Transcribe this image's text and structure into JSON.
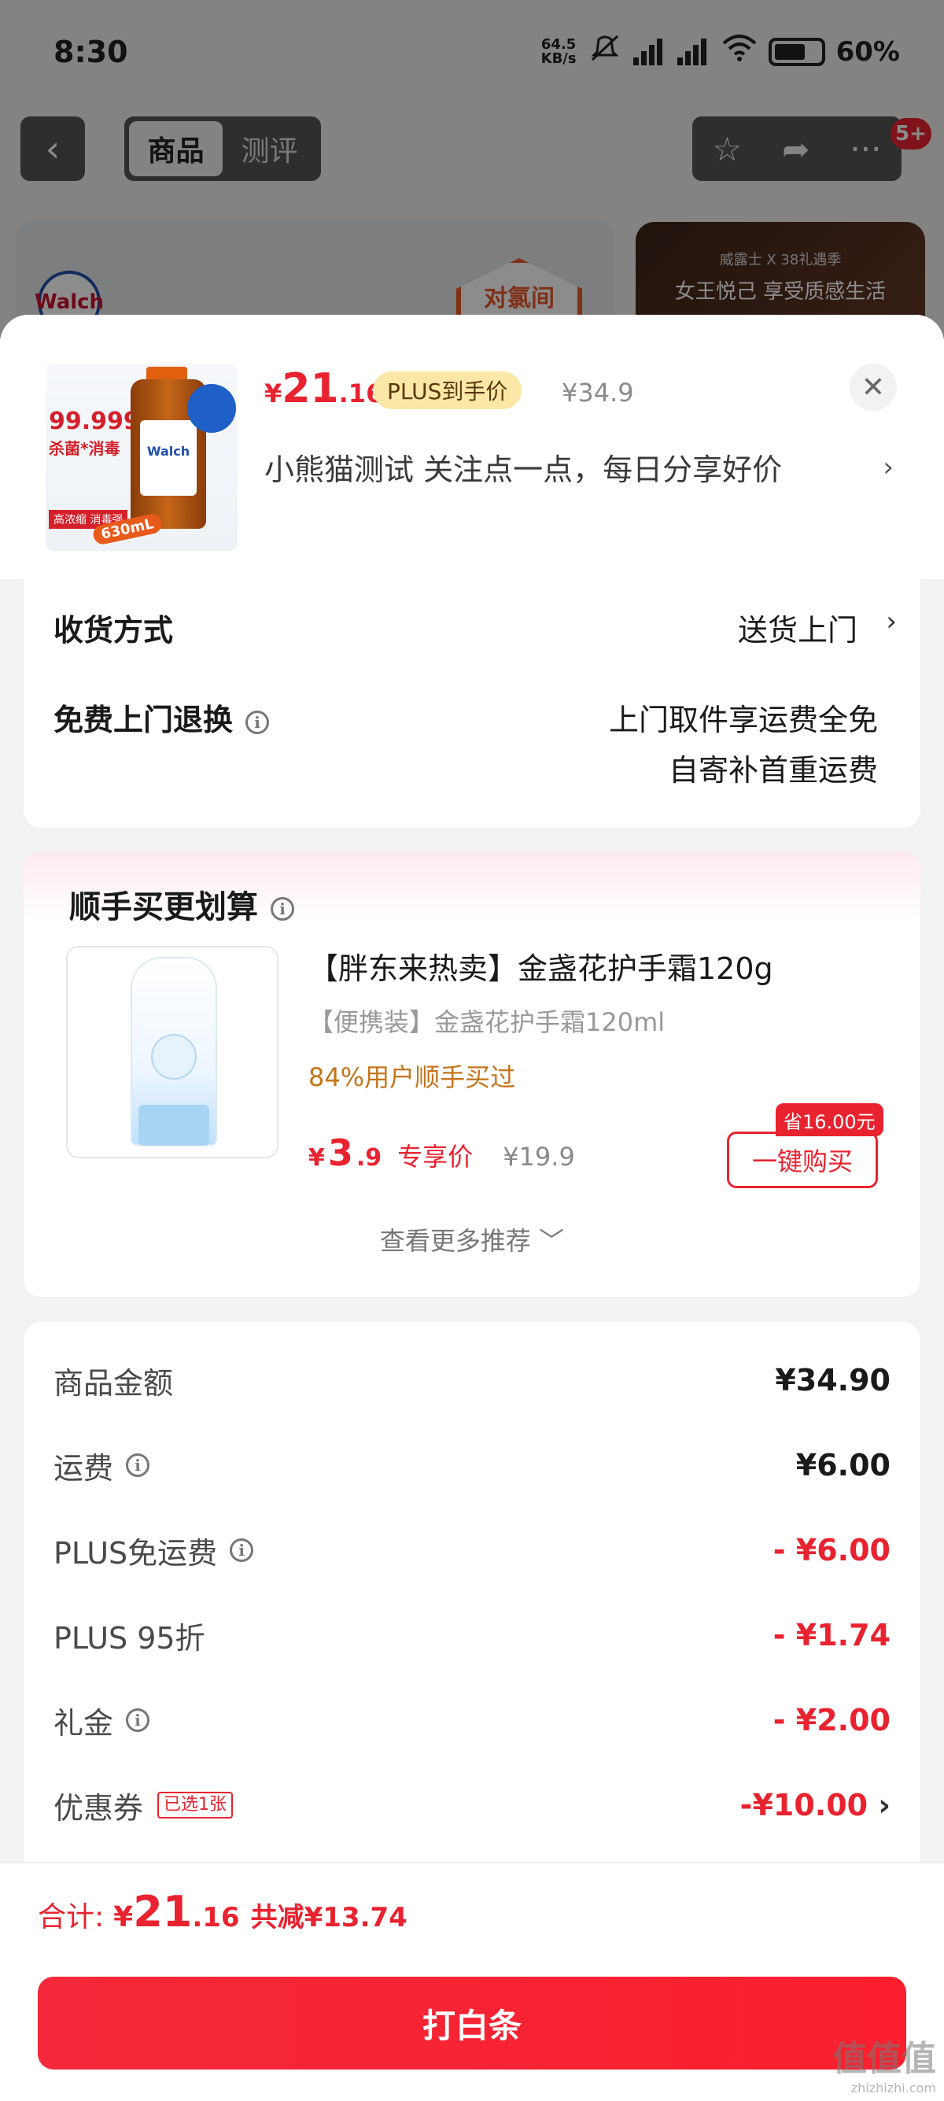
{
  "status": {
    "time": "8:30",
    "speed": "64.5",
    "speed_unit": "KB/s",
    "battery": "60%"
  },
  "nav": {
    "tabs": [
      "商品",
      "测评"
    ],
    "badge": "5+"
  },
  "background": {
    "logo": "Walch",
    "hero_tag": "对氯间",
    "ad_small": "威露士 X 38礼遇季",
    "ad_main": "女王悦己 享受质感生活"
  },
  "product": {
    "price_symbol": "¥",
    "price_int": "21",
    "price_dec": ".16",
    "plus_label": "PLUS到手价",
    "original_price": "¥34.9",
    "shop_line": "小熊猫测试  关注点一点，每日分享好价",
    "thumb": {
      "pct": "99.999%",
      "sub": "杀菌*消毒",
      "tag": "高浓缩 消毒强",
      "brand": "Walch",
      "volume": "630mL"
    }
  },
  "delivery": {
    "method_label": "收货方式",
    "method_value": "送货上门",
    "return_label": "免费上门退换",
    "return_value_1": "上门取件享运费全免",
    "return_value_2": "自寄补首重运费"
  },
  "recommend": {
    "title": "顺手买更划算",
    "name": "【胖东来热卖】金盏花护手霜120g",
    "sub": "【便携装】金盏花护手霜120ml",
    "bought": "84%用户顺手买过",
    "price_symbol": "¥",
    "price_int": "3",
    "price_dec": ".9",
    "price_label": "专享价",
    "original_price": "¥19.9",
    "save_badge": "省16.00元",
    "buy_button": "一键购买",
    "more": "查看更多推荐 ﹀"
  },
  "summary": [
    {
      "label": "商品金额",
      "value": "¥34.90",
      "info": false,
      "red": false
    },
    {
      "label": "运费",
      "value": "¥6.00",
      "info": true,
      "red": false
    },
    {
      "label": "PLUS免运费",
      "value": "- ¥6.00",
      "info": true,
      "red": true
    },
    {
      "label": "PLUS 95折",
      "value": "- ¥1.74",
      "info": false,
      "red": true
    },
    {
      "label": "礼金",
      "value": "- ¥2.00",
      "info": true,
      "red": true
    },
    {
      "label": "优惠券",
      "value": "-¥10.00",
      "info": false,
      "red": true,
      "tag": "已选1张"
    }
  ],
  "total": {
    "label": "合计:",
    "symbol": "¥",
    "int": "21",
    "dec": ".16",
    "saved": "共减¥13.74"
  },
  "pay_button": "打白条",
  "watermark": {
    "main": "值值值",
    "sub": "zhizhizhi.com"
  },
  "colors": {
    "accent": "#e8232f",
    "plus_tag_bg": "#fbe7a8",
    "bought_text": "#c4741a"
  }
}
